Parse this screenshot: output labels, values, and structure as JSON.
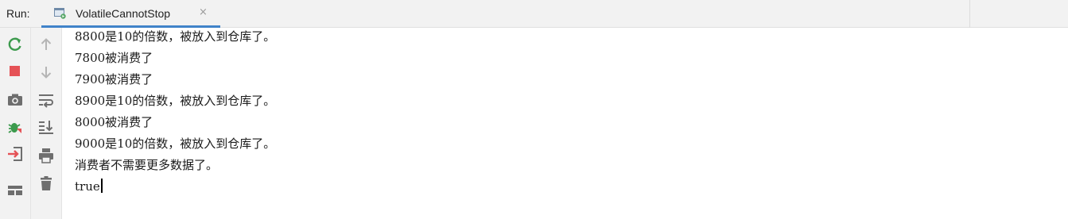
{
  "run_panel": {
    "label": "Run:",
    "tab": {
      "title": "VolatileCannotStop",
      "icon": "run-config-icon",
      "close": "×"
    }
  },
  "toolbar": {
    "left": [
      {
        "icon": "rerun-icon",
        "color": "#3c9a4d"
      },
      {
        "icon": "stop-icon",
        "color": "#e55256"
      },
      {
        "icon": "camera-icon",
        "color": "#6e6e6e"
      },
      {
        "icon": "debug-bug-icon",
        "color": "#3c9a4d"
      },
      {
        "icon": "exit-icon",
        "color": "#e55256"
      },
      {
        "icon": "layout-icon",
        "color": "#6e6e6e"
      }
    ],
    "right": [
      {
        "icon": "arrow-up-icon",
        "color": "#b5b5b5"
      },
      {
        "icon": "arrow-down-icon",
        "color": "#b5b5b5"
      },
      {
        "icon": "soft-wrap-icon",
        "color": "#6e6e6e"
      },
      {
        "icon": "scroll-to-end-icon",
        "color": "#6e6e6e"
      },
      {
        "icon": "print-icon",
        "color": "#6e6e6e"
      },
      {
        "icon": "trash-icon",
        "color": "#6e6e6e"
      }
    ]
  },
  "console": {
    "lines": [
      "8800是10的倍数，被放入到仓库了。",
      "7800被消费了",
      "7900被消费了",
      "8900是10的倍数，被放入到仓库了。",
      "8000被消费了",
      "9000是10的倍数，被放入到仓库了。",
      "消费者不需要更多数据了。",
      "true"
    ]
  }
}
